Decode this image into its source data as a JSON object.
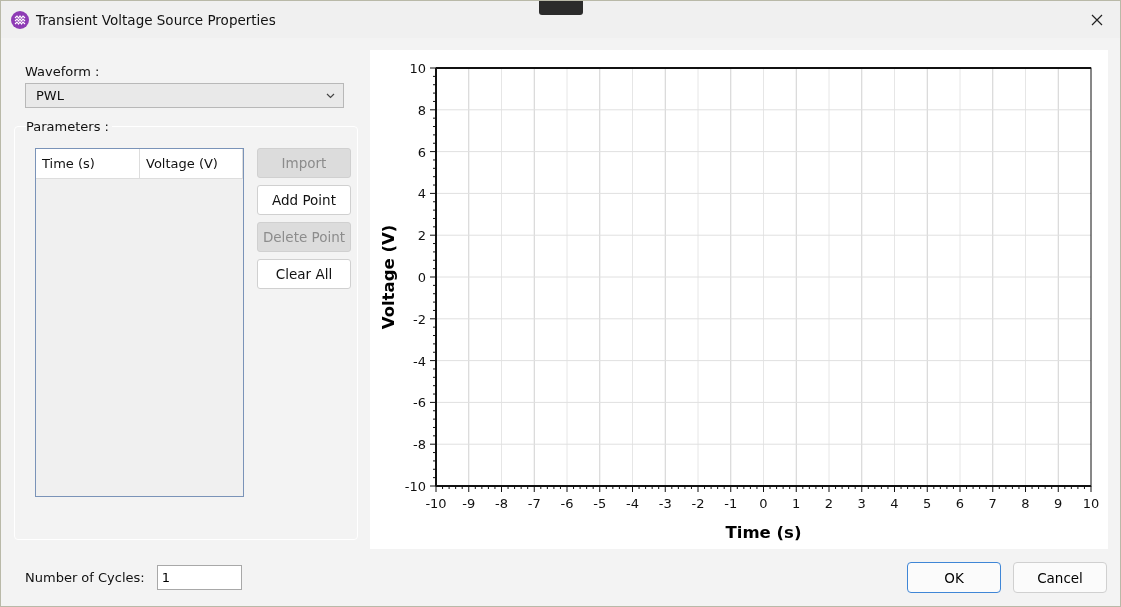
{
  "window": {
    "title": "Transient Voltage Source Properties"
  },
  "waveform": {
    "label": "Waveform :",
    "value": "PWL"
  },
  "parameters": {
    "label": "Parameters :",
    "table": {
      "columns": [
        "Time (s)",
        "Voltage (V)"
      ]
    },
    "buttons": [
      {
        "label": "Import",
        "disabled": true
      },
      {
        "label": "Add Point",
        "disabled": false
      },
      {
        "label": "Delete Point",
        "disabled": true
      },
      {
        "label": "Clear All",
        "disabled": false
      }
    ]
  },
  "chart": {
    "chart_data": {
      "type": "line",
      "xlabel": "Time (s)",
      "ylabel": "Voltage (V)",
      "xlim": [
        -10,
        10
      ],
      "ylim": [
        -10,
        10
      ],
      "xticks": [
        -10,
        -9,
        -8,
        -7,
        -6,
        -5,
        -4,
        -3,
        -2,
        -1,
        0,
        1,
        2,
        3,
        4,
        5,
        6,
        7,
        8,
        9,
        10
      ],
      "yticks": [
        -10,
        -8,
        -6,
        -4,
        -2,
        0,
        2,
        4,
        6,
        8,
        10
      ],
      "grid": true
    }
  },
  "cycles": {
    "label": "Number of Cycles:",
    "value": "1"
  },
  "dialog_buttons": [
    {
      "label": "OK",
      "primary": true
    },
    {
      "label": "Cancel",
      "primary": false
    }
  ]
}
